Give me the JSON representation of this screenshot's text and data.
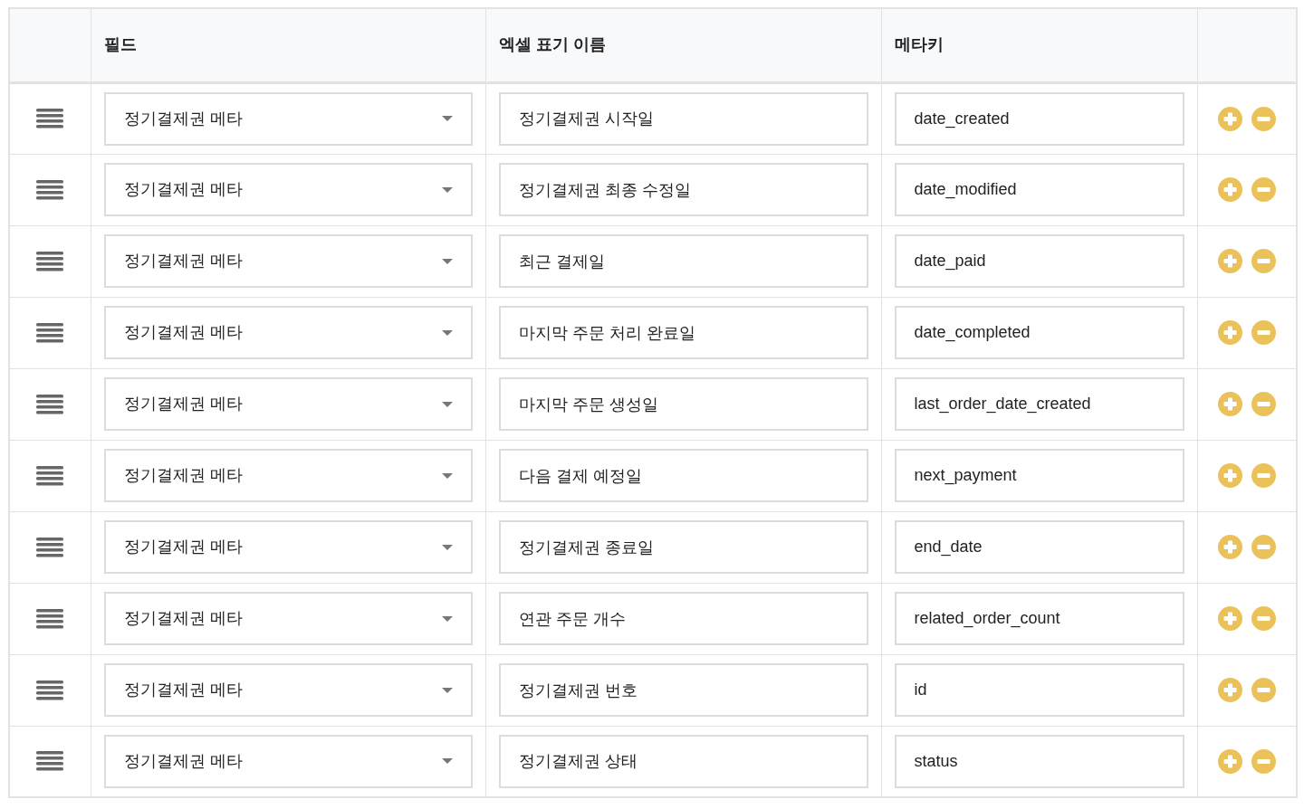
{
  "table": {
    "columns": [
      "필드",
      "엑셀 표기 이름",
      "메타키"
    ],
    "rows": [
      {
        "field": "정기결제권 메타",
        "label": "정기결제권 시작일",
        "meta_key": "date_created"
      },
      {
        "field": "정기결제권 메타",
        "label": "정기결제권 최종 수정일",
        "meta_key": "date_modified"
      },
      {
        "field": "정기결제권 메타",
        "label": "최근 결제일",
        "meta_key": "date_paid"
      },
      {
        "field": "정기결제권 메타",
        "label": "마지막 주문 처리 완료일",
        "meta_key": "date_completed"
      },
      {
        "field": "정기결제권 메타",
        "label": "마지막 주문 생성일",
        "meta_key": "last_order_date_created"
      },
      {
        "field": "정기결제권 메타",
        "label": "다음 결제 예정일",
        "meta_key": "next_payment"
      },
      {
        "field": "정기결제권 메타",
        "label": "정기결제권 종료일",
        "meta_key": "end_date"
      },
      {
        "field": "정기결제권 메타",
        "label": "연관 주문 개수",
        "meta_key": "related_order_count"
      },
      {
        "field": "정기결제권 메타",
        "label": "정기결제권 번호",
        "meta_key": "id"
      },
      {
        "field": "정기결제권 메타",
        "label": "정기결제권 상태",
        "meta_key": "status"
      }
    ]
  }
}
